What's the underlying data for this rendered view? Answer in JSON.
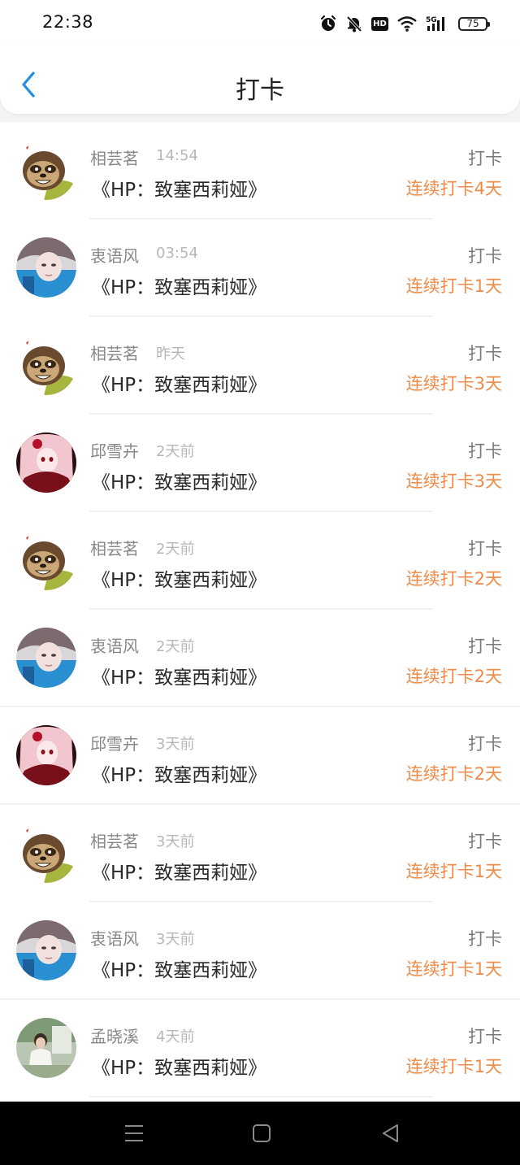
{
  "status_bar": {
    "time": "22:38",
    "icons": [
      "alarm-icon",
      "mute-bell-icon",
      "hd-badge",
      "wifi-icon",
      "5g-signal-icon",
      "battery-icon"
    ],
    "hd_label": "HD",
    "battery_level": "75"
  },
  "header": {
    "title": "打卡",
    "back_icon": "chevron-left-icon",
    "accent_color": "#1e8ee6"
  },
  "colors": {
    "streak": "#ef8b46",
    "name": "#888888",
    "time": "#b7b7b7"
  },
  "items": [
    {
      "user": "相芸茗",
      "avatar": "sloth-avatar",
      "time": "14:54",
      "book": "《HP：致塞西莉娅》",
      "action": "打卡",
      "streak": "连续打卡4天"
    },
    {
      "user": "衷语风",
      "avatar": "blue-photo-avatar",
      "time": "03:54",
      "book": "《HP：致塞西莉娅》",
      "action": "打卡",
      "streak": "连续打卡1天"
    },
    {
      "user": "相芸茗",
      "avatar": "sloth-avatar",
      "time": "昨天",
      "book": "《HP：致塞西莉娅》",
      "action": "打卡",
      "streak": "连续打卡3天"
    },
    {
      "user": "邱雪卉",
      "avatar": "anime-avatar",
      "time": "2天前",
      "book": "《HP：致塞西莉娅》",
      "action": "打卡",
      "streak": "连续打卡3天"
    },
    {
      "user": "相芸茗",
      "avatar": "sloth-avatar",
      "time": "2天前",
      "book": "《HP：致塞西莉娅》",
      "action": "打卡",
      "streak": "连续打卡2天"
    },
    {
      "user": "衷语风",
      "avatar": "blue-photo-avatar",
      "time": "2天前",
      "book": "《HP：致塞西莉娅》",
      "action": "打卡",
      "streak": "连续打卡2天"
    },
    {
      "user": "邱雪卉",
      "avatar": "anime-avatar",
      "time": "3天前",
      "book": "《HP：致塞西莉娅》",
      "action": "打卡",
      "streak": "连续打卡2天"
    },
    {
      "user": "相芸茗",
      "avatar": "sloth-avatar",
      "time": "3天前",
      "book": "《HP：致塞西莉娅》",
      "action": "打卡",
      "streak": "连续打卡1天"
    },
    {
      "user": "衷语风",
      "avatar": "blue-photo-avatar",
      "time": "3天前",
      "book": "《HP：致塞西莉娅》",
      "action": "打卡",
      "streak": "连续打卡1天"
    },
    {
      "user": "孟晓溪",
      "avatar": "garden-photo-avatar",
      "time": "4天前",
      "book": "《HP：致塞西莉娅》",
      "action": "打卡",
      "streak": "连续打卡1天"
    }
  ],
  "bottom_nav": [
    "menu-icon",
    "home-icon",
    "back-triangle-icon"
  ]
}
